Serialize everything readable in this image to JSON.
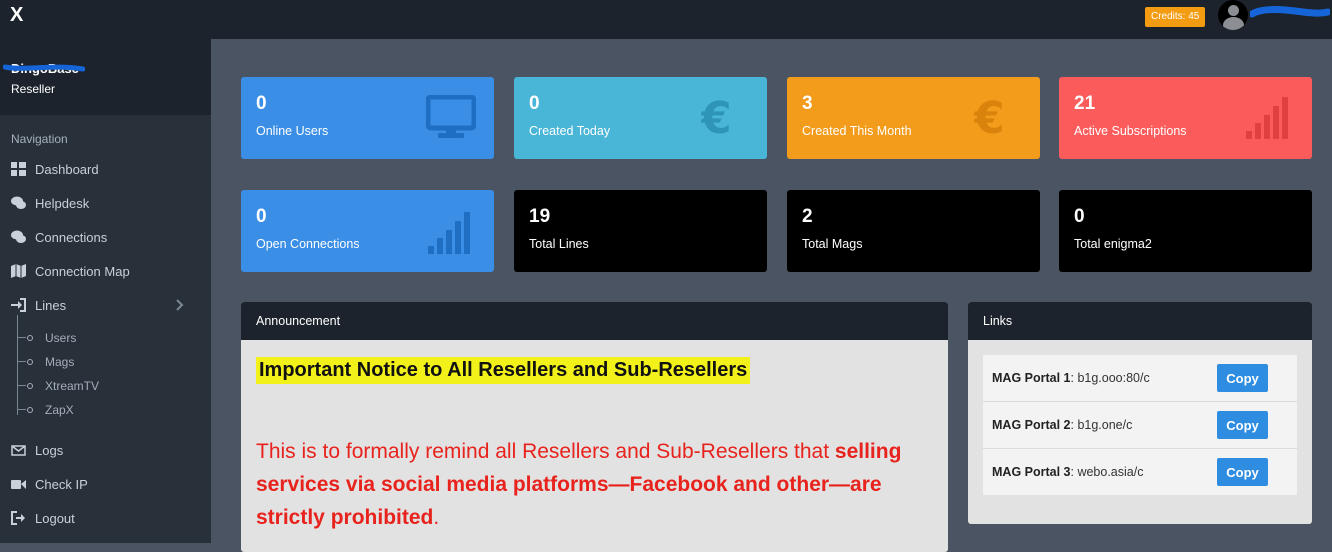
{
  "brand": "X",
  "header": {
    "credits": "Credits: 45"
  },
  "sidebar": {
    "username": "DingoBase",
    "role": "Reseller",
    "nav_heading": "Navigation",
    "items": [
      {
        "label": "Dashboard",
        "icon": "dashboard-icon"
      },
      {
        "label": "Helpdesk",
        "icon": "comments-icon"
      },
      {
        "label": "Connections",
        "icon": "comments-icon"
      },
      {
        "label": "Connection Map",
        "icon": "map-icon"
      },
      {
        "label": "Lines",
        "icon": "sign-in-icon"
      },
      {
        "label": "Logs",
        "icon": "envelope-icon"
      },
      {
        "label": "Check IP",
        "icon": "video-camera-icon"
      },
      {
        "label": "Logout",
        "icon": "logout-icon"
      }
    ],
    "lines_sub": [
      "Users",
      "Mags",
      "XtreamTV",
      "ZapX"
    ]
  },
  "stats": [
    {
      "value": "0",
      "label": "Online Users",
      "color": "#3a8ee6",
      "icon": "monitor-icon"
    },
    {
      "value": "0",
      "label": "Created Today",
      "color": "#49b5d7",
      "icon": "euro-icon"
    },
    {
      "value": "3",
      "label": "Created This Month",
      "color": "#f39b1b",
      "icon": "euro-icon"
    },
    {
      "value": "21",
      "label": "Active Subscriptions",
      "color": "#fb5b5b",
      "icon": "signal-bars-icon"
    },
    {
      "value": "0",
      "label": "Open Connections",
      "color": "#3a8ee6",
      "icon": "signal-bars-icon"
    },
    {
      "value": "19",
      "label": "Total Lines",
      "color": "#000000",
      "icon": ""
    },
    {
      "value": "2",
      "label": "Total Mags",
      "color": "#000000",
      "icon": ""
    },
    {
      "value": "0",
      "label": "Total enigma2",
      "color": "#000000",
      "icon": ""
    }
  ],
  "announcement": {
    "heading": "Announcement",
    "title": "Important Notice to All Resellers and Sub-Resellers",
    "body_intro": "This is to formally remind all Resellers and Sub-Resellers that ",
    "body_bold": "selling services via social media platforms—Facebook and other—are strictly prohibited",
    "body_end": "."
  },
  "links": {
    "heading": "Links",
    "rows": [
      {
        "name": "MAG Portal 1",
        "url": "b1g.ooo:80/c",
        "button": "Copy"
      },
      {
        "name": "MAG Portal 2",
        "url": "b1g.one/c",
        "button": "Copy"
      },
      {
        "name": "MAG Portal 3",
        "url": "webo.asia/c",
        "button": "Copy"
      }
    ]
  }
}
